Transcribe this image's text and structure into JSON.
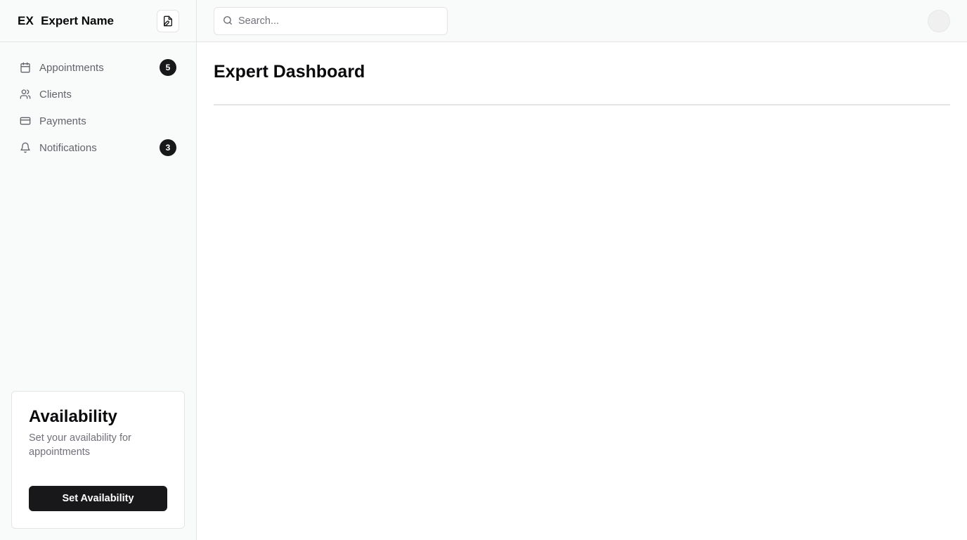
{
  "sidebar": {
    "brand_abbr": "EX",
    "brand_name": "Expert Name",
    "header_button_icon": "file-edit-icon",
    "items": [
      {
        "label": "Appointments",
        "icon": "calendar-icon",
        "badge": "5"
      },
      {
        "label": "Clients",
        "icon": "users-icon",
        "badge": null
      },
      {
        "label": "Payments",
        "icon": "credit-card-icon",
        "badge": null
      },
      {
        "label": "Notifications",
        "icon": "bell-icon",
        "badge": "3"
      }
    ],
    "availability": {
      "title": "Availability",
      "description": "Set your availability for appointments",
      "button_label": "Set Availability"
    }
  },
  "header": {
    "search_placeholder": "Search...",
    "search_value": ""
  },
  "main": {
    "title": "Expert Dashboard"
  },
  "colors": {
    "primary": "#18181b",
    "sidebar_bg": "#f9fafa",
    "border": "#e4e4e7",
    "muted_text": "#71717a"
  }
}
